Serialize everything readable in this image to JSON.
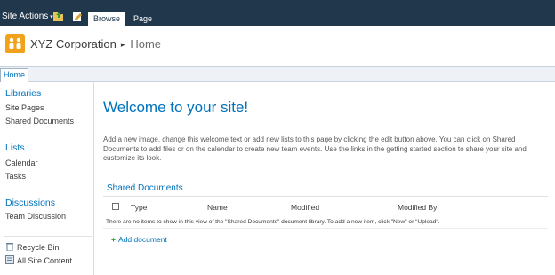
{
  "ribbon": {
    "site_actions": "Site Actions",
    "caret": "▾",
    "icons": [
      "navigate-up-icon",
      "edit-page-icon"
    ],
    "tabs": [
      "Browse",
      "Page"
    ]
  },
  "header": {
    "site_name": "XYZ Corporation",
    "separator": "▸",
    "current_page": "Home"
  },
  "topnav": {
    "home": "Home"
  },
  "leftnav": {
    "libraries": {
      "heading": "Libraries",
      "items": [
        "Site Pages",
        "Shared Documents"
      ]
    },
    "lists": {
      "heading": "Lists",
      "items": [
        "Calendar",
        "Tasks"
      ]
    },
    "discussions": {
      "heading": "Discussions",
      "items": [
        "Team Discussion"
      ]
    },
    "footer": [
      "Recycle Bin",
      "All Site Content"
    ]
  },
  "main": {
    "title": "Welcome to your site!",
    "intro": "Add a new image, change this welcome text or add new lists to this page by clicking the edit button above. You can click on Shared Documents to add files or on the calendar to create new team events. Use the links in the getting started section to share your site and customize its look.",
    "webpart": {
      "title": "Shared Documents",
      "columns": [
        "Type",
        "Name",
        "Modified",
        "Modified By"
      ],
      "empty_message": "There are no items to show in this view of the \"Shared Documents\" document library. To add a new item, click \"New\" or \"Upload\".",
      "add_label": "Add document",
      "add_glyph": "+"
    }
  },
  "colors": {
    "ribbon_bg": "#21374c",
    "link_blue": "#0072bc",
    "logo_orange": "#f2a21a",
    "add_green": "#3a9a2a"
  }
}
